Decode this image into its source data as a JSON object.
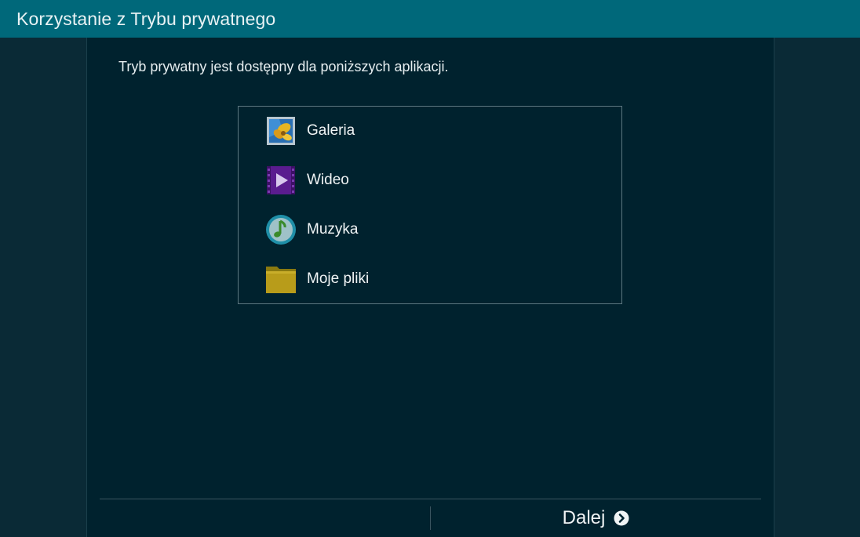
{
  "header": {
    "title": "Korzystanie z Trybu prywatnego"
  },
  "main": {
    "description": "Tryb prywatny jest dostępny dla poniższych aplikacji.",
    "apps": [
      {
        "label": "Galeria",
        "icon": "gallery-icon"
      },
      {
        "label": "Wideo",
        "icon": "video-icon"
      },
      {
        "label": "Muzyka",
        "icon": "music-icon"
      },
      {
        "label": "Moje pliki",
        "icon": "my-files-folder-icon"
      }
    ]
  },
  "footer": {
    "next_label": "Dalej",
    "next_icon": "chevron-right-circle-icon"
  },
  "colors": {
    "header_bg": "#00687a",
    "content_bg": "#00222e",
    "side_bg": "#0a2a36"
  }
}
